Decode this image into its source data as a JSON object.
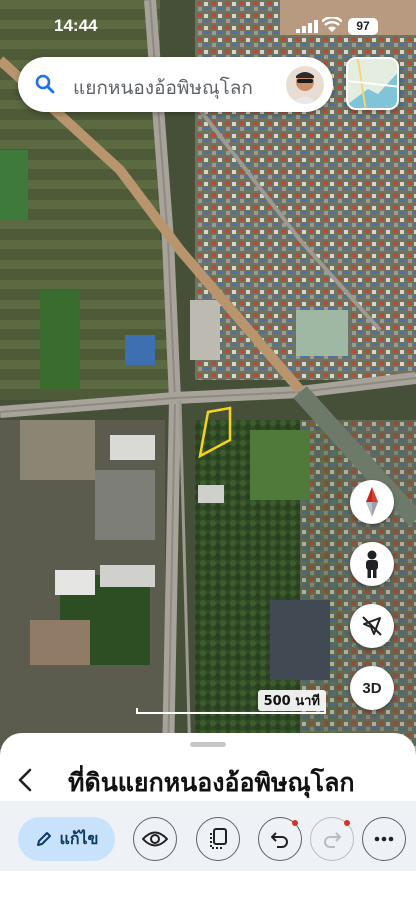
{
  "status": {
    "time": "14:44",
    "battery": "97"
  },
  "search": {
    "query": "แยกหนองอ้อพิษณุโลก",
    "search_icon": "search-icon",
    "avatar": "user-avatar"
  },
  "map": {
    "type": "satellite",
    "scale_label": "500 นาที"
  },
  "controls": {
    "three_d_label": "3D",
    "compass": "compass-icon",
    "street_view": "pegman-icon",
    "north_lock": "navigation-off-icon"
  },
  "place": {
    "title": "ที่ดินแยกหนองอ้อพิษณุโลก"
  },
  "toolbar": {
    "edit_label": "แก้ไข",
    "buttons": [
      "pencil-icon",
      "eye-icon",
      "copy-icon",
      "undo-icon",
      "redo-icon",
      "more-icon"
    ]
  },
  "colors": {
    "accent": "#c9e2fb",
    "boundary": "#f5d21c",
    "notify_dot": "#d93025"
  }
}
